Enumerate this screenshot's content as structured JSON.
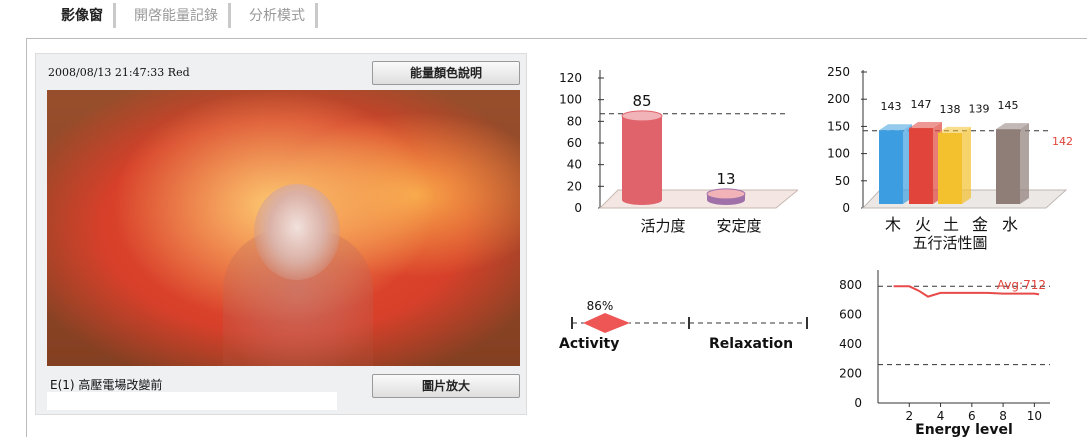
{
  "tabs": [
    {
      "label": "影像窗",
      "active": true
    },
    {
      "label": "開啓能量記錄",
      "active": false
    },
    {
      "label": "分析模式",
      "active": false
    }
  ],
  "image_panel": {
    "timestamp": "2008/08/13 21:47:33  Red",
    "legend_button": "能量顏色說明",
    "caption": "E(1) 高壓電場改變前",
    "zoom_button": "圖片放大"
  },
  "vitality_chart": {
    "type": "bar",
    "categories": [
      "活力度",
      "安定度"
    ],
    "values": [
      85,
      13
    ],
    "yticks": [
      "0",
      "20",
      "40",
      "60",
      "80",
      "100",
      "120"
    ],
    "ylim": [
      0,
      120
    ],
    "reference_line": 87,
    "colors": [
      "#e0636b",
      "#a070a8"
    ]
  },
  "five_element_chart": {
    "type": "bar",
    "title": "五行活性圖",
    "categories": [
      "木",
      "火",
      "土",
      "金",
      "水"
    ],
    "values": [
      143,
      147,
      138,
      139,
      145
    ],
    "yticks": [
      "0",
      "50",
      "100",
      "150",
      "200",
      "250"
    ],
    "ylim": [
      0,
      250
    ],
    "average_label": "142",
    "average": 142,
    "colors": [
      "#3c9ee0",
      "#e0443a",
      "#f3c12d",
      "#ffffff",
      "#8f7e78"
    ]
  },
  "activity_scale": {
    "percent_label": "86%",
    "left_label": "Activity",
    "right_label": "Relaxation"
  },
  "energy_chart": {
    "type": "line",
    "xlabel": "Energy level",
    "avg_label": "Avg:712",
    "xticks": [
      "2",
      "4",
      "6",
      "8",
      "10"
    ],
    "yticks": [
      "0",
      "200",
      "400",
      "600",
      "800"
    ],
    "ylim": [
      0,
      900
    ],
    "ref_high": 790,
    "ref_low": 260,
    "x": [
      1,
      2,
      2.6,
      3.2,
      4,
      5,
      6,
      7,
      8,
      9,
      10,
      10.3
    ],
    "y": [
      790,
      790,
      760,
      720,
      745,
      745,
      745,
      745,
      740,
      740,
      740,
      735
    ]
  },
  "chart_data": [
    {
      "type": "bar",
      "categories": [
        "活力度",
        "安定度"
      ],
      "values": [
        85,
        13
      ],
      "ylim": [
        0,
        120
      ],
      "grid": false
    },
    {
      "type": "bar",
      "title": "五行活性圖",
      "categories": [
        "木",
        "火",
        "土",
        "金",
        "水"
      ],
      "values": [
        143,
        147,
        138,
        139,
        145
      ],
      "annotation": "142",
      "ylim": [
        0,
        250
      ],
      "grid": false
    },
    {
      "type": "line",
      "xlabel": "Energy level",
      "annotation": "Avg:712",
      "x": [
        1,
        2,
        2.6,
        3.2,
        4,
        5,
        6,
        7,
        8,
        9,
        10,
        10.3
      ],
      "y": [
        790,
        790,
        760,
        720,
        745,
        745,
        745,
        745,
        740,
        740,
        740,
        735
      ],
      "ylim": [
        0,
        900
      ],
      "grid": false
    }
  ]
}
